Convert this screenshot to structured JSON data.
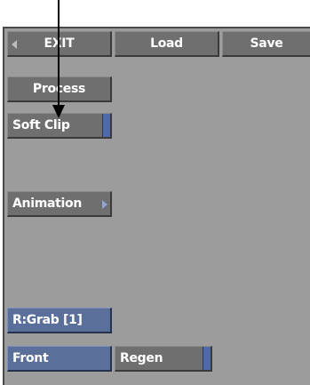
{
  "toolbar": {
    "exit_label": "EXIT",
    "load_label": "Load",
    "save_label": "Save"
  },
  "menu": {
    "process_label": "Process",
    "soft_clip_label": "Soft Clip",
    "animation_label": "Animation"
  },
  "footer": {
    "grab_label": "R:Grab [1]",
    "front_label": "Front",
    "regen_label": "Regen"
  },
  "colors": {
    "panel": "#9c9c9c",
    "button_gray": "#6f6f6f",
    "button_blue": "#5a6f9a",
    "accent_stripe": "#4f6aa6",
    "callout_arrow": "#000000"
  },
  "icons": {
    "exit_arrow": "left-triangle-icon",
    "animation_arrow": "right-triangle-icon",
    "callout": "down-arrow-pointer"
  }
}
